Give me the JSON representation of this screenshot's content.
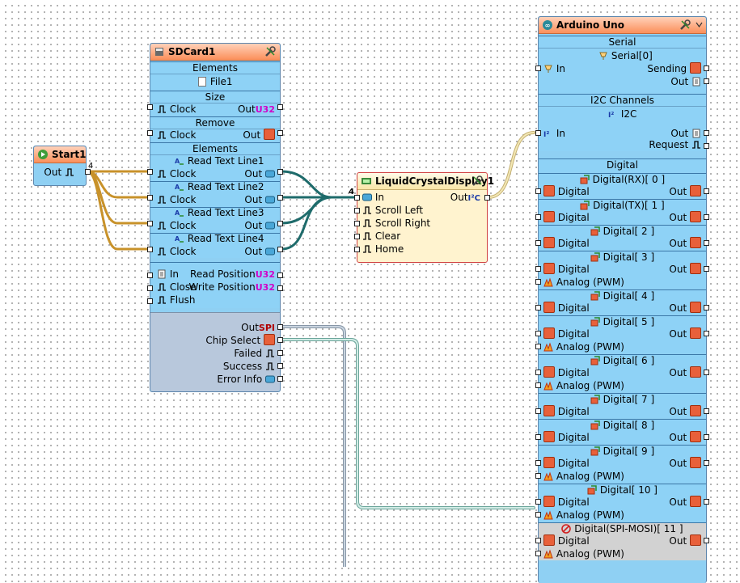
{
  "start": {
    "title": "Start1",
    "out_label": "Out",
    "fanout": "4"
  },
  "sdcard": {
    "title": "SDCard1",
    "elements_header": "Elements",
    "file_item": "File1",
    "size_header": "Size",
    "remove_header": "Remove",
    "elements2_header": "Elements",
    "clock_label": "Clock",
    "out_label": "Out",
    "u32_label": "U32",
    "read_lines": [
      "Read Text Line1",
      "Read Text Line2",
      "Read Text Line3",
      "Read Text Line4"
    ],
    "in_label": "In",
    "close_label": "Close",
    "flush_label": "Flush",
    "read_position": "Read Position",
    "write_position": "Write Position",
    "spi_out": "Out",
    "spi_badge": "SPI",
    "chip_select": "Chip Select",
    "failed": "Failed",
    "success": "Success",
    "error_info": "Error Info"
  },
  "lcd": {
    "title": "LiquidCrystalDisplay1",
    "in_count": "4",
    "in_label": "In",
    "out_label": "Out",
    "out_badge": "I²C",
    "inputs": [
      "Scroll Left",
      "Scroll Right",
      "Clear",
      "Home"
    ]
  },
  "arduino": {
    "title": "Arduino Uno",
    "serial_header": "Serial",
    "serial_item": "Serial[0]",
    "serial_in": "In",
    "sending": "Sending",
    "serial_out": "Out",
    "i2c_header": "I2C Channels",
    "i2c_item": "I2C",
    "i2c_in": "In",
    "i2c_out": "Out",
    "request": "Request",
    "digital_header": "Digital",
    "digital_label": "Digital",
    "analog_label": "Analog (PWM)",
    "out_label": "Out",
    "pins": [
      {
        "name": "Digital(RX)[ 0 ]"
      },
      {
        "name": "Digital(TX)[ 1 ]"
      },
      {
        "name": "Digital[ 2 ]"
      },
      {
        "name": "Digital[ 3 ]"
      },
      {
        "name": "Digital[ 4 ]"
      },
      {
        "name": "Digital[ 5 ]"
      },
      {
        "name": "Digital[ 6 ]"
      },
      {
        "name": "Digital[ 7 ]"
      },
      {
        "name": "Digital[ 8 ]"
      },
      {
        "name": "Digital[ 9 ]"
      },
      {
        "name": "Digital[ 10 ]"
      },
      {
        "name": "Digital(SPI-MOSI)[ 11 ]"
      }
    ]
  },
  "colors": {
    "wire_clock": "#c8922a",
    "wire_text": "#1e6b6b",
    "wire_i2c": "#e3d49a",
    "wire_spi": "#a7b6c6",
    "wire_cs": "#a8d0c8",
    "node_blue": "#8fd0f3",
    "title_orange": "#fb8f5a",
    "lcd_bg": "#fff3cf"
  },
  "icons": [
    "play-icon",
    "wrench-icon",
    "sdcard-icon",
    "file-icon",
    "clock-icon",
    "text-icon",
    "lcd-icon",
    "arduino-icon",
    "serial-icon",
    "i2c-icon",
    "digital-icon",
    "analog-icon",
    "disabled-icon"
  ]
}
